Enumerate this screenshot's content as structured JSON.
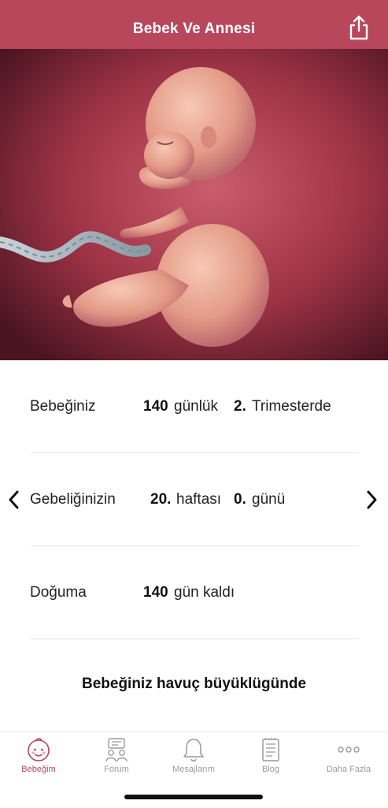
{
  "header": {
    "title": "Bebek Ve Annesi",
    "background": "#b9475c"
  },
  "hero": {
    "icon": "fetus-illustration"
  },
  "stats": {
    "row1": {
      "label": "Bebeğiniz",
      "value": "140",
      "unit": "günlük",
      "trimester_value": "2.",
      "trimester_unit": "Trimesterde"
    },
    "row2": {
      "label": "Gebeliğinizin",
      "week_value": "20.",
      "week_unit": "haftası",
      "day_value": "0.",
      "day_unit": "günü"
    },
    "row3": {
      "label": "Doğuma",
      "value": "140",
      "unit": "gün kaldı"
    }
  },
  "size_text": "Bebeğiniz havuç büyüklügünde",
  "tabbar": {
    "tabs": [
      {
        "label": "Bebeğim",
        "icon": "baby-face-icon",
        "active": true
      },
      {
        "label": "Forum",
        "icon": "forum-people-icon",
        "active": false
      },
      {
        "label": "Mesajlarım",
        "icon": "bell-icon",
        "active": false
      },
      {
        "label": "Blog",
        "icon": "document-icon",
        "active": false
      },
      {
        "label": "Daha Fazla",
        "icon": "more-dots-icon",
        "active": false
      }
    ],
    "active_color": "#b9475c",
    "inactive_color": "#9a9a9a"
  }
}
